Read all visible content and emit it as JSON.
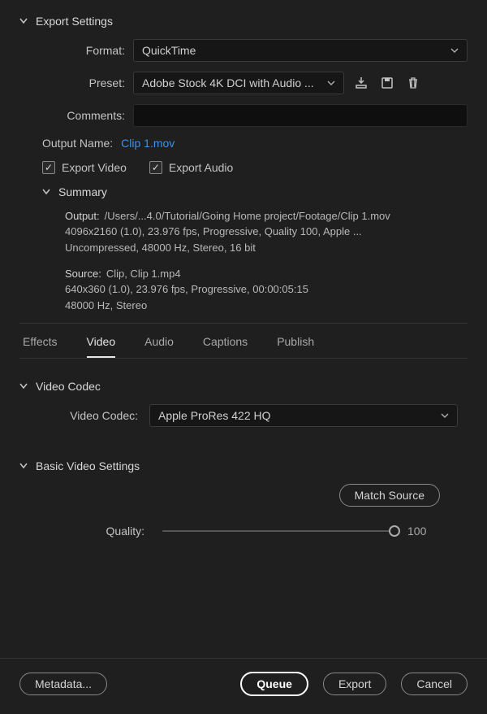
{
  "header": {
    "title": "Export Settings"
  },
  "format": {
    "label": "Format:",
    "value": "QuickTime"
  },
  "preset": {
    "label": "Preset:",
    "value": "Adobe Stock 4K DCI with Audio ..."
  },
  "comments": {
    "label": "Comments:",
    "value": ""
  },
  "output_name": {
    "label": "Output Name:",
    "value": "Clip 1.mov"
  },
  "checks": {
    "export_video": {
      "label": "Export Video",
      "checked": true
    },
    "export_audio": {
      "label": "Export Audio",
      "checked": true
    }
  },
  "summary": {
    "title": "Summary",
    "output": {
      "label": "Output:",
      "line1": "/Users/...4.0/Tutorial/Going Home project/Footage/Clip 1.mov",
      "line2": "4096x2160 (1.0), 23.976 fps, Progressive, Quality 100, Apple ...",
      "line3": "Uncompressed, 48000 Hz, Stereo, 16 bit"
    },
    "source": {
      "label": "Source:",
      "line1": "Clip, Clip 1.mp4",
      "line2": "640x360 (1.0), 23.976 fps, Progressive, 00:00:05:15",
      "line3": "48000 Hz, Stereo"
    }
  },
  "tabs": {
    "effects": "Effects",
    "video": "Video",
    "audio": "Audio",
    "captions": "Captions",
    "publish": "Publish",
    "active": "video"
  },
  "video_codec": {
    "section": "Video Codec",
    "label": "Video Codec:",
    "value": "Apple ProRes 422 HQ"
  },
  "basic_video": {
    "section": "Basic Video Settings",
    "match_source": "Match Source",
    "quality_label": "Quality:",
    "quality_value": "100"
  },
  "footer": {
    "metadata": "Metadata...",
    "queue": "Queue",
    "export": "Export",
    "cancel": "Cancel"
  },
  "icons": {
    "import": "import-preset-icon",
    "save": "save-preset-icon",
    "delete": "delete-preset-icon"
  }
}
